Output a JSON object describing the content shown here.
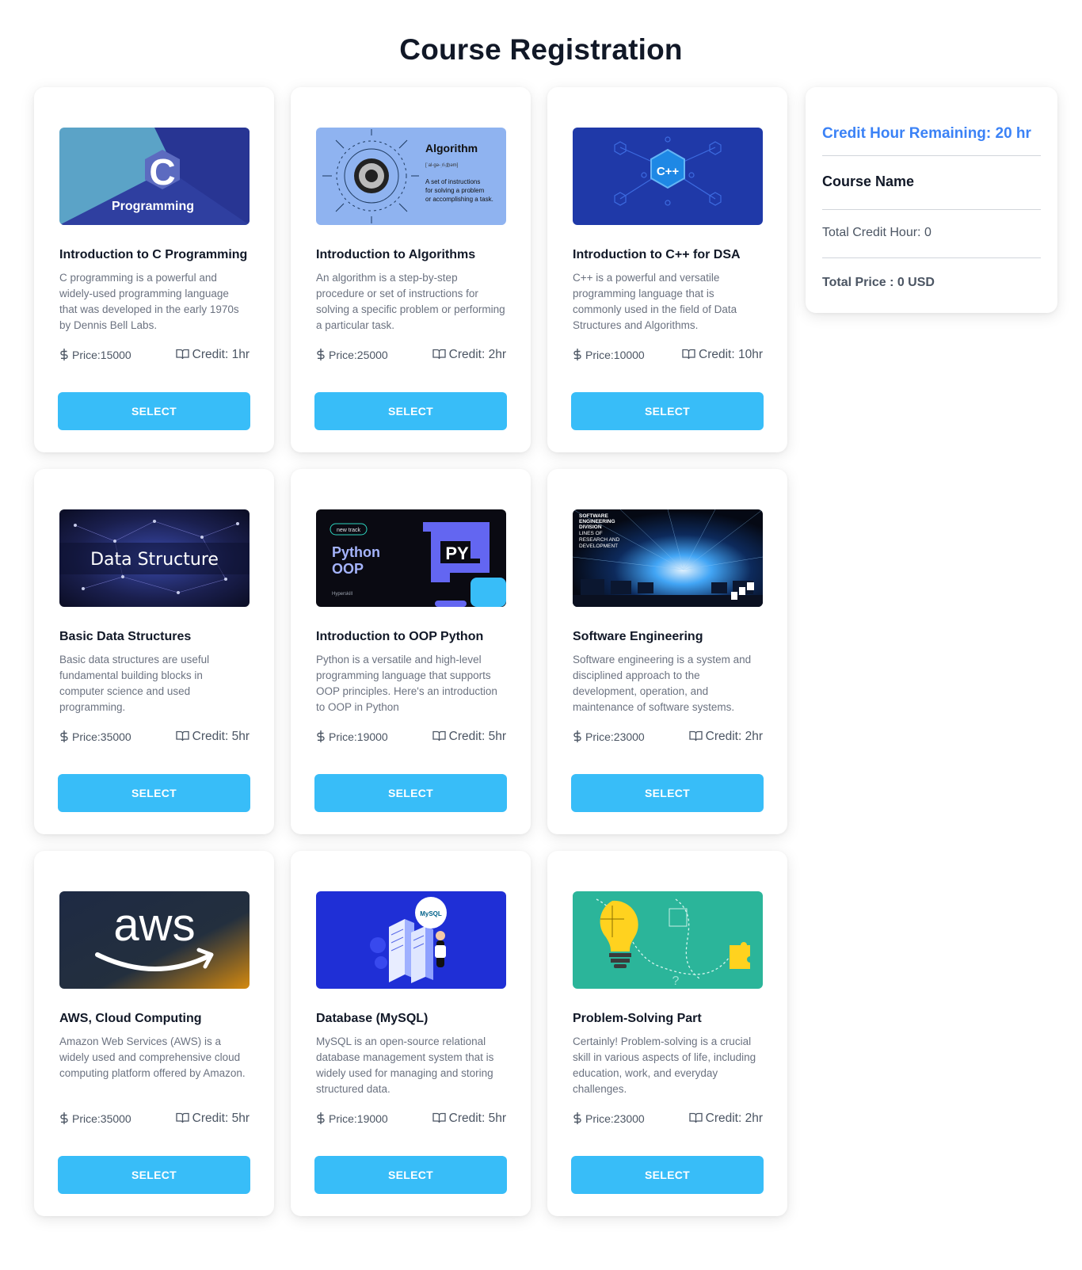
{
  "page": {
    "title": "Course Registration"
  },
  "colors": {
    "accent": "#38bdf8",
    "highlight": "#3b82f6"
  },
  "courses": [
    {
      "title": "Introduction to C Programming",
      "description": "C programming is a powerful and widely-used programming language that was developed in the early 1970s by Dennis Bell Labs.",
      "price": "Price:15000",
      "credit": "Credit: 1hr",
      "button": "SELECT",
      "image": {
        "caption": "Programming",
        "glyph": "C"
      }
    },
    {
      "title": "Introduction to Algorithms",
      "description": "An algorithm is a step-by-step procedure or set of instructions for solving a specific problem or performing a particular task.",
      "price": "Price:25000",
      "credit": "Credit: 2hr",
      "button": "SELECT",
      "image": {
        "heading": "Algorithm",
        "phonetic": "[ˈal-gə-ˌri-t͟həm]",
        "line1": "A set of instructions",
        "line2": "for solving a problem",
        "line3": "or accomplishing a task."
      }
    },
    {
      "title": "Introduction to C++ for DSA",
      "description": "C++ is a powerful and versatile programming language that is commonly used in the field of Data Structures and Algorithms.",
      "price": "Price:10000",
      "credit": "Credit: 10hr",
      "button": "SELECT",
      "image": {
        "glyph": "C++"
      }
    },
    {
      "title": "Basic Data Structures",
      "description": "Basic data structures are useful fundamental building blocks in computer science and used programming.",
      "price": "Price:35000",
      "credit": "Credit: 5hr",
      "button": "SELECT",
      "image": {
        "caption": "Data Structure"
      }
    },
    {
      "title": "Introduction to OOP Python",
      "description": "Python is a versatile and high-level programming language that supports OOP principles. Here's an introduction to OOP in Python",
      "price": "Price:19000",
      "credit": "Credit: 5hr",
      "button": "SELECT",
      "image": {
        "tag": "new track",
        "line1": "Python",
        "line2": "OOP",
        "glyph": "PY",
        "brand": "Hyperskill"
      }
    },
    {
      "title": "Software Engineering",
      "description": "Software engineering is a system and disciplined approach to the development, operation, and maintenance of software systems.",
      "price": "Price:23000",
      "credit": "Credit: 2hr",
      "button": "SELECT",
      "image": {
        "line1": "SOFTWARE",
        "line2": "ENGINEERING",
        "line3": "DIVISION",
        "line4": "LINES OF",
        "line5": "RESEARCH AND",
        "line6": "DEVELOPMENT"
      }
    },
    {
      "title": "AWS, Cloud Computing",
      "description": "Amazon Web Services (AWS) is a widely used and comprehensive cloud computing platform offered by Amazon.",
      "price": "Price:35000",
      "credit": "Credit: 5hr",
      "button": "SELECT",
      "image": {
        "logo": "aws"
      }
    },
    {
      "title": "Database (MySQL)",
      "description": "MySQL is an open-source relational database management system that is widely used for managing and storing structured data.",
      "price": "Price:19000",
      "credit": "Credit: 5hr",
      "button": "SELECT",
      "image": {
        "logo": "MySQL"
      }
    },
    {
      "title": "Problem-Solving Part",
      "description": "Certainly! Problem-solving is a crucial skill in various aspects of life, including education, work, and everyday challenges.",
      "price": "Price:23000",
      "credit": "Credit: 2hr",
      "button": "SELECT",
      "image": {
        "mark": "?"
      }
    }
  ],
  "summary": {
    "credit_remaining": "Credit Hour Remaining: 20 hr",
    "course_name_header": "Course Name",
    "total_credit": "Total Credit Hour: 0",
    "total_price": "Total Price : 0 USD"
  },
  "icons": {
    "price": "dollar-icon",
    "credit": "book-open-icon"
  }
}
